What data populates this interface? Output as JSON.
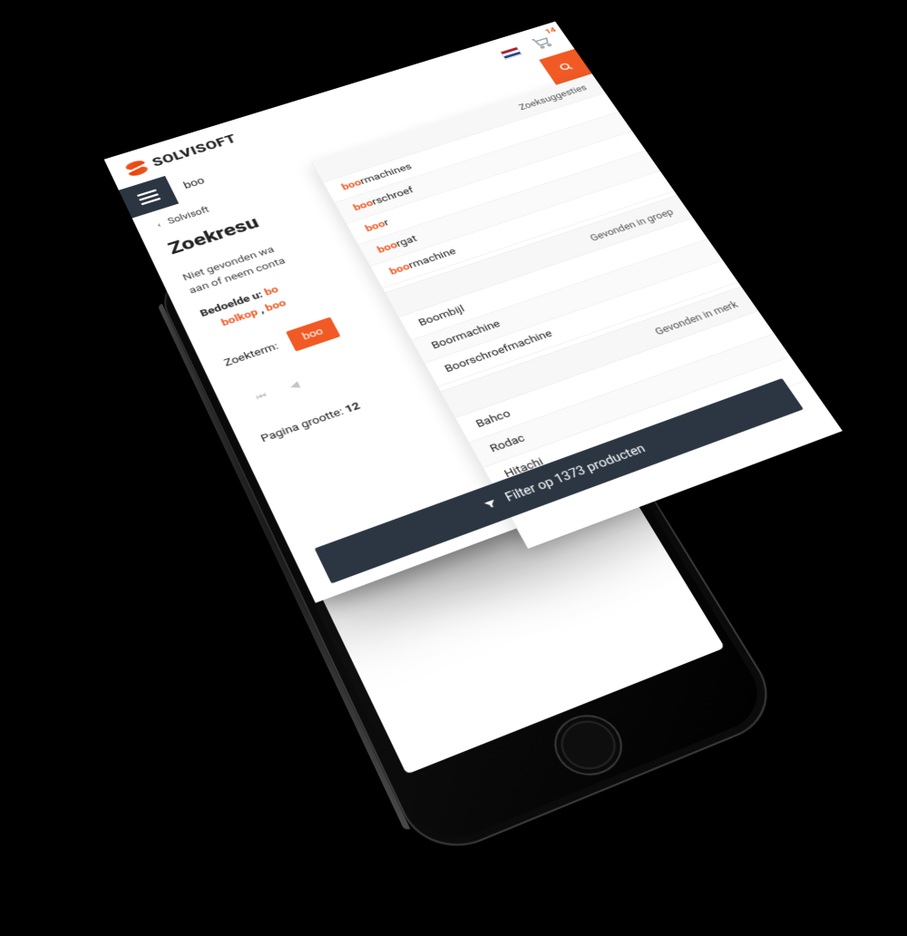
{
  "brand": "SOLVISOFT",
  "cart_count": "14",
  "search": {
    "value": "boo"
  },
  "breadcrumb": {
    "chev": "‹",
    "label": "Solvisoft"
  },
  "page_title": "Zoekresu",
  "not_found_line1": "Niet gevonden wa",
  "not_found_line2": "aan of neem conta",
  "dym_label": "Bedoelde u:",
  "dym_term1": "bo",
  "dym_term2": "bolkop",
  "dym_sep": ",",
  "dym_term3": "boo",
  "term_label": "Zoekterm:",
  "term_chip": "boo",
  "pager": {
    "first": "⏮",
    "prev": "◀"
  },
  "page_size_label": "Pagina grootte:",
  "page_size_value": "12",
  "suggestions_header": "Zoeksuggesties",
  "suggestions": [
    {
      "prefix": "boo",
      "rest": "rmachines"
    },
    {
      "prefix": "boo",
      "rest": "rschroef"
    },
    {
      "prefix": "boo",
      "rest": "r"
    },
    {
      "prefix": "boo",
      "rest": "rgat"
    },
    {
      "prefix": "boo",
      "rest": "rmachine"
    }
  ],
  "group_header": "Gevonden in groep",
  "groups": [
    "Boombijl",
    "Boormachine",
    "Boorschroefmachine"
  ],
  "brand_header": "Gevonden in merk",
  "brands": [
    "Bahco",
    "Rodac",
    "Hitachi"
  ],
  "filter_label": "Filter op 1373 producten"
}
